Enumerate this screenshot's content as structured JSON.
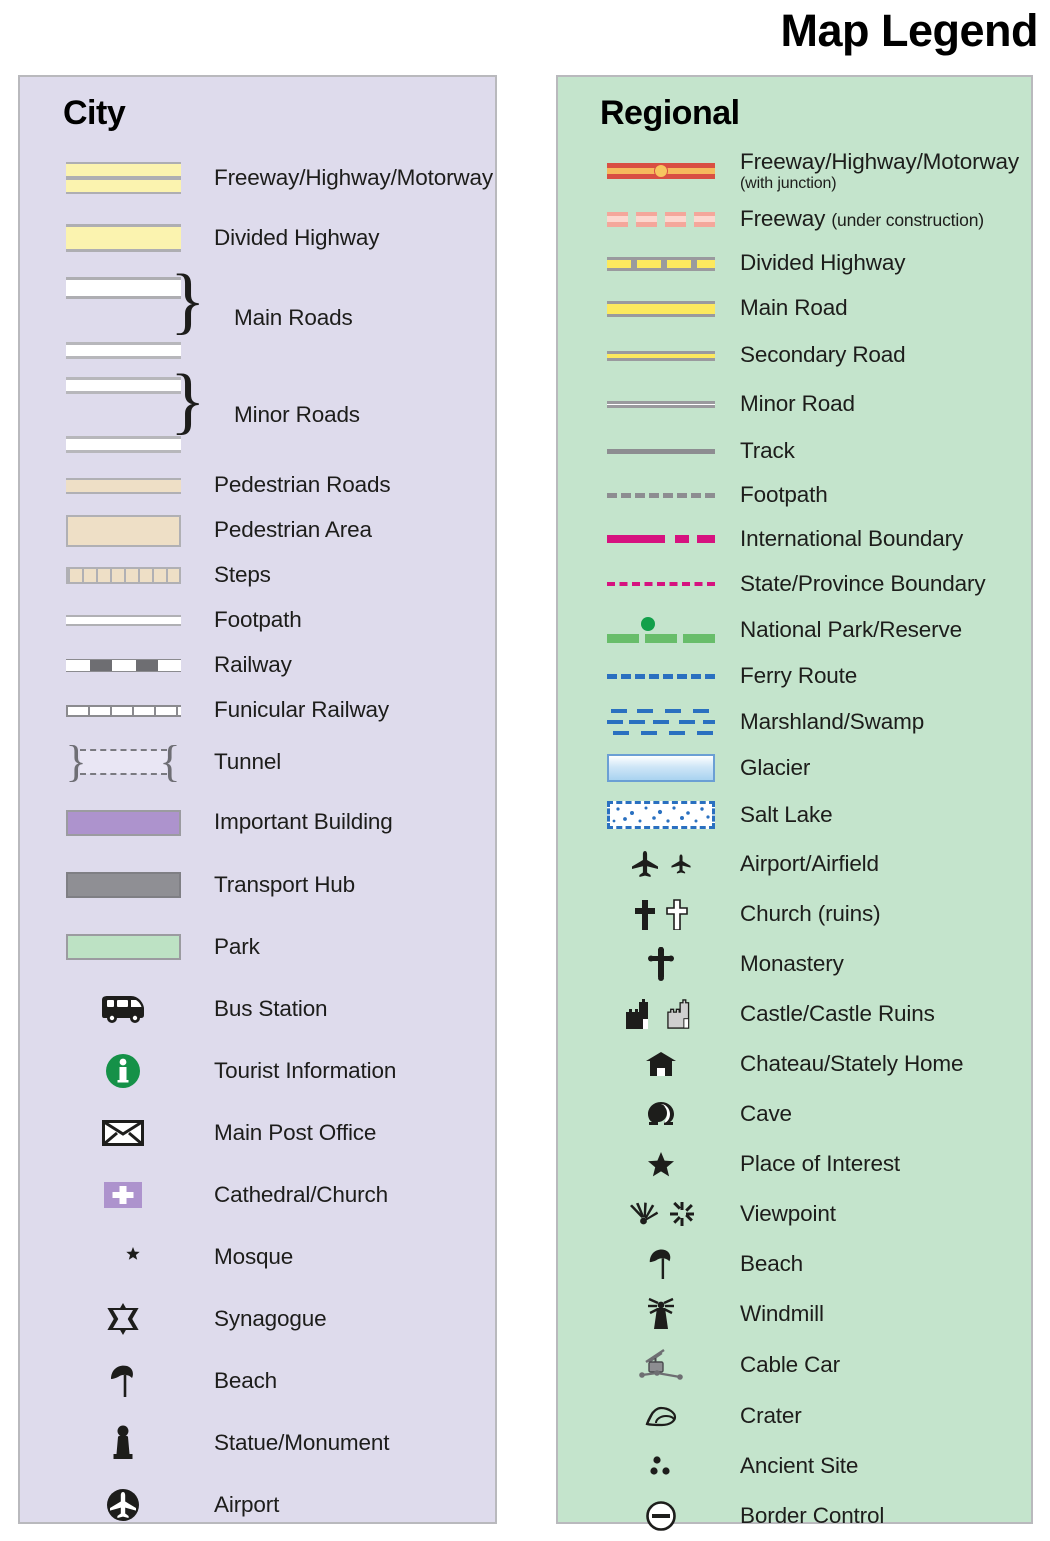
{
  "title": "Map Legend",
  "colors": {
    "city_panel_bg": "#dedbec",
    "regional_panel_bg": "#c4e4cc",
    "panel_border": "#b9b9bd",
    "road_yellow": "#fbf3af",
    "regional_yellow": "#fce95e",
    "freeway_red": "#d94f43",
    "freeway_orange": "#f6b95d",
    "boundary_magenta": "#d6127f",
    "park_green": "#68bd6a",
    "water_blue": "#2a70c0",
    "important_building_purple": "#ad93cd",
    "transport_hub_grey": "#8f8f94",
    "park_swatch_green": "#bde2c4",
    "pedestrian_tan": "#eedfc6",
    "tourist_info_green": "#159148"
  },
  "city": {
    "heading": "City",
    "items": [
      {
        "symbol": "freeway-swatch",
        "label": "Freeway/Highway/Motorway"
      },
      {
        "symbol": "divided-highway-swatch",
        "label": "Divided Highway"
      },
      {
        "symbol": "main-roads-swatch",
        "label": "Main Roads"
      },
      {
        "symbol": "minor-roads-swatch",
        "label": "Minor Roads"
      },
      {
        "symbol": "pedestrian-roads-swatch",
        "label": "Pedestrian Roads"
      },
      {
        "symbol": "pedestrian-area-swatch",
        "label": "Pedestrian Area"
      },
      {
        "symbol": "steps-swatch",
        "label": "Steps"
      },
      {
        "symbol": "footpath-swatch",
        "label": "Footpath"
      },
      {
        "symbol": "railway-swatch",
        "label": "Railway"
      },
      {
        "symbol": "funicular-railway-swatch",
        "label": "Funicular Railway"
      },
      {
        "symbol": "tunnel-swatch",
        "label": "Tunnel"
      },
      {
        "symbol": "important-building-swatch",
        "label": "Important Building"
      },
      {
        "symbol": "transport-hub-swatch",
        "label": "Transport Hub"
      },
      {
        "symbol": "park-swatch",
        "label": "Park"
      },
      {
        "symbol": "bus-icon",
        "label": "Bus Station"
      },
      {
        "symbol": "tourist-information-icon",
        "label": "Tourist Information"
      },
      {
        "symbol": "envelope-icon",
        "label": "Main Post Office"
      },
      {
        "symbol": "cathedral-church-icon",
        "label": "Cathedral/Church"
      },
      {
        "symbol": "mosque-icon",
        "label": "Mosque"
      },
      {
        "symbol": "synagogue-icon",
        "label": "Synagogue"
      },
      {
        "symbol": "beach-umbrella-icon",
        "label": "Beach"
      },
      {
        "symbol": "statue-monument-icon",
        "label": "Statue/Monument"
      },
      {
        "symbol": "airport-icon",
        "label": "Airport"
      }
    ]
  },
  "regional": {
    "heading": "Regional",
    "items": [
      {
        "symbol": "freeway-junction-swatch",
        "label": "Freeway/Highway/Motorway",
        "sub": "(with junction)"
      },
      {
        "symbol": "freeway-construction-swatch",
        "label": "Freeway ",
        "inline": "(under construction)"
      },
      {
        "symbol": "divided-highway-swatch",
        "label": "Divided Highway"
      },
      {
        "symbol": "main-road-swatch",
        "label": "Main Road"
      },
      {
        "symbol": "secondary-road-swatch",
        "label": "Secondary Road"
      },
      {
        "symbol": "minor-road-swatch",
        "label": "Minor Road"
      },
      {
        "symbol": "track-swatch",
        "label": "Track"
      },
      {
        "symbol": "footpath-swatch",
        "label": "Footpath"
      },
      {
        "symbol": "international-boundary-swatch",
        "label": "International Boundary"
      },
      {
        "symbol": "state-boundary-swatch",
        "label": "State/Province Boundary"
      },
      {
        "symbol": "national-park-swatch",
        "label": "National Park/Reserve"
      },
      {
        "symbol": "ferry-route-swatch",
        "label": "Ferry Route"
      },
      {
        "symbol": "marshland-swatch",
        "label": "Marshland/Swamp"
      },
      {
        "symbol": "glacier-swatch",
        "label": "Glacier"
      },
      {
        "symbol": "salt-lake-swatch",
        "label": "Salt Lake"
      },
      {
        "symbol": "airport-airfield-icon",
        "label": "Airport/Airfield"
      },
      {
        "symbol": "church-ruins-icon",
        "label": "Church (ruins)"
      },
      {
        "symbol": "monastery-cross-icon",
        "label": "Monastery"
      },
      {
        "symbol": "castle-icon",
        "label": "Castle/Castle Ruins"
      },
      {
        "symbol": "chateau-icon",
        "label": "Chateau/Stately Home"
      },
      {
        "symbol": "cave-icon",
        "label": "Cave"
      },
      {
        "symbol": "star-icon",
        "label": "Place of Interest"
      },
      {
        "symbol": "viewpoint-icon",
        "label": "Viewpoint"
      },
      {
        "symbol": "beach-umbrella-icon",
        "label": "Beach"
      },
      {
        "symbol": "windmill-icon",
        "label": "Windmill"
      },
      {
        "symbol": "cable-car-icon",
        "label": "Cable Car"
      },
      {
        "symbol": "crater-icon",
        "label": "Crater"
      },
      {
        "symbol": "ancient-site-icon",
        "label": "Ancient Site"
      },
      {
        "symbol": "border-control-icon",
        "label": "Border Control"
      }
    ]
  }
}
